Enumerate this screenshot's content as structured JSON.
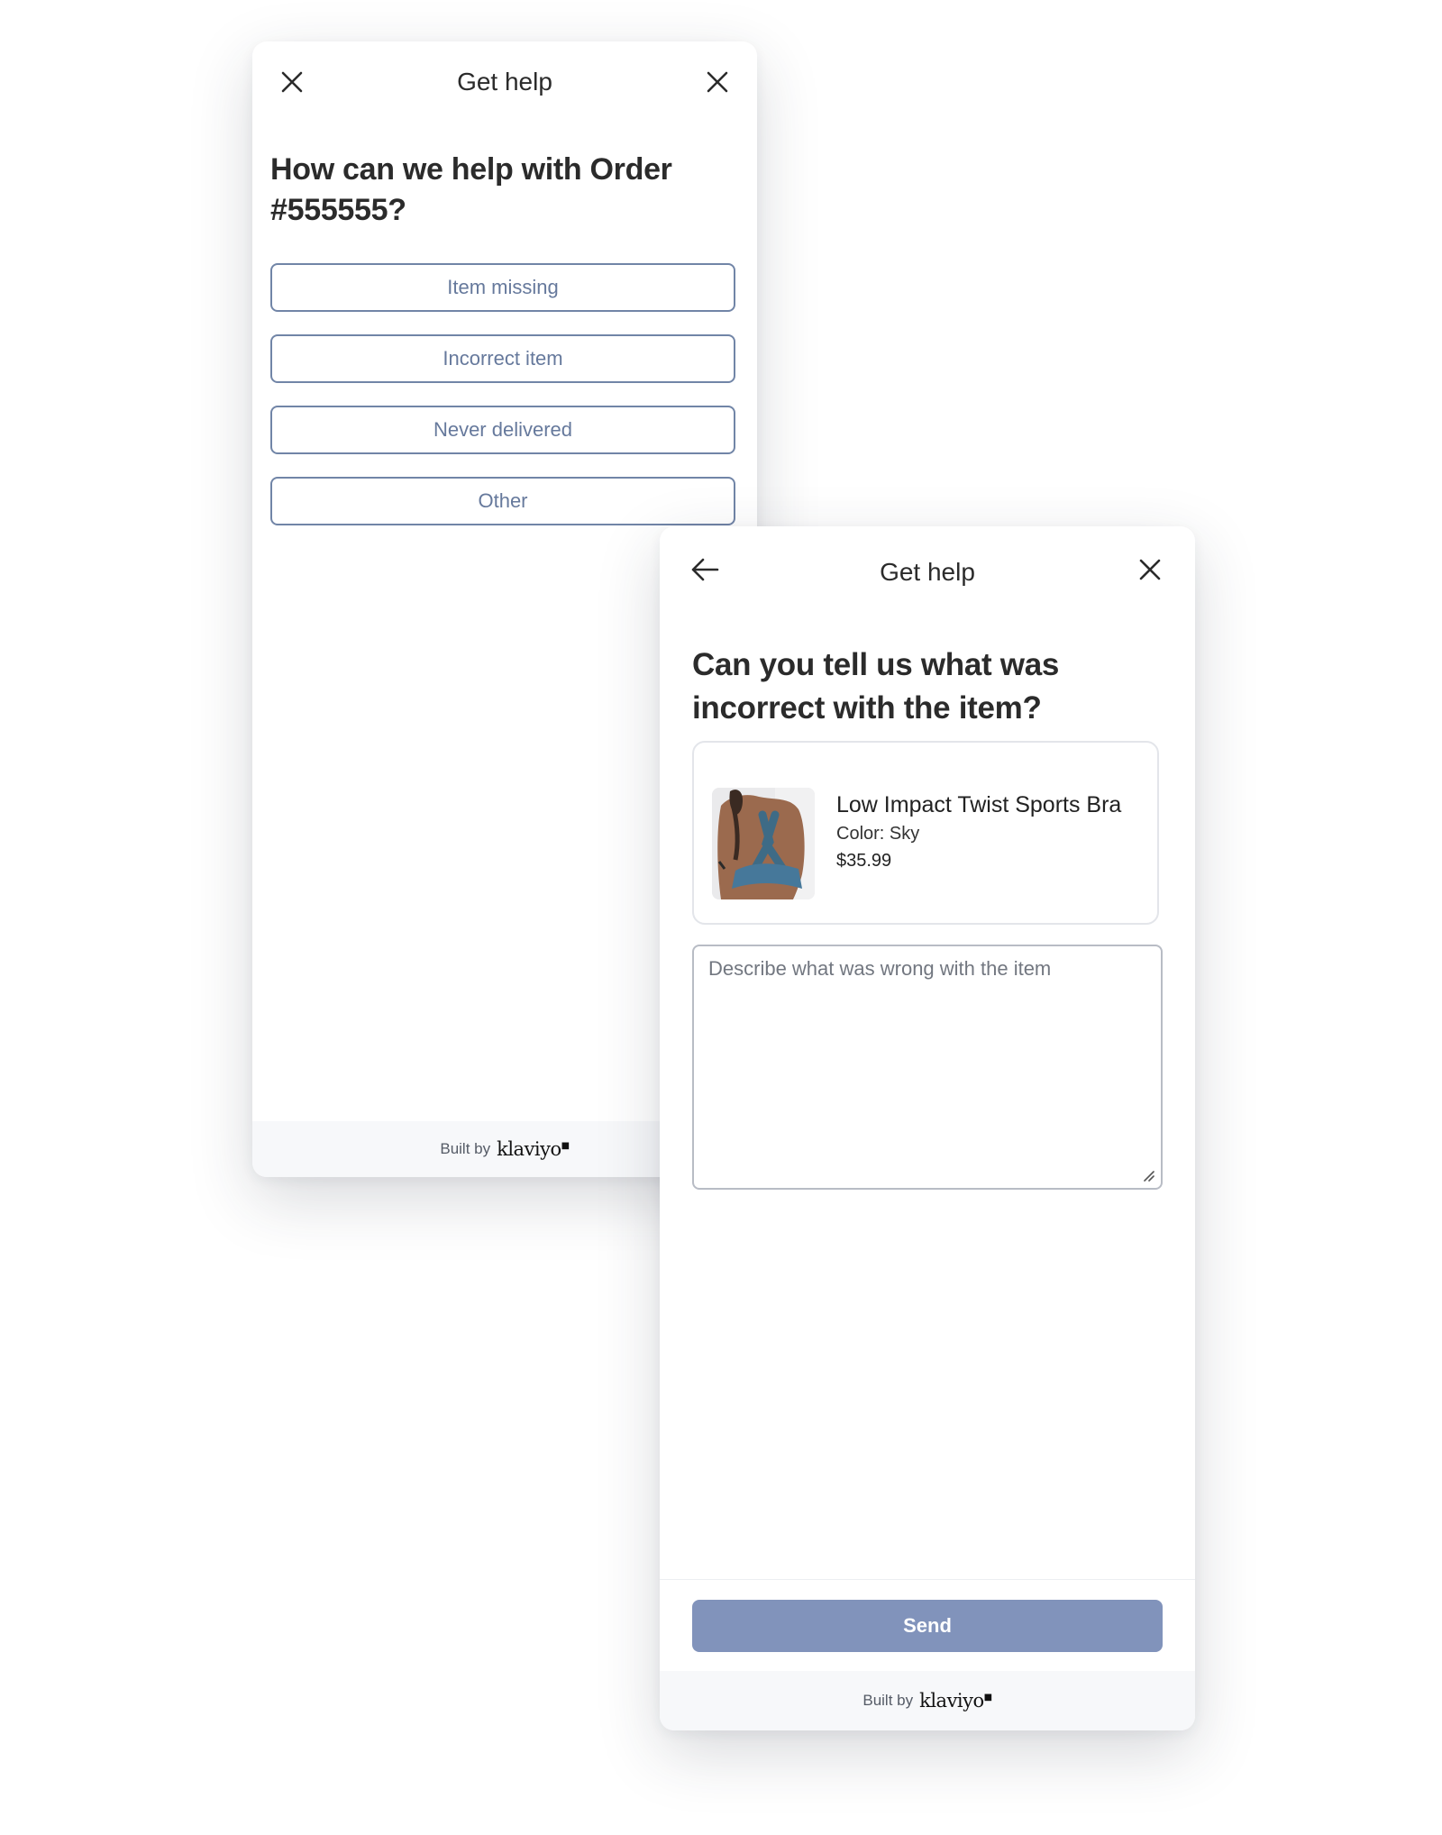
{
  "card1": {
    "header": {
      "title": "Get help",
      "left_icon": "close-icon",
      "right_icon": "close-icon"
    },
    "question": "How can we help with Order #555555?",
    "options": [
      {
        "label": "Item missing"
      },
      {
        "label": "Incorrect item"
      },
      {
        "label": "Never delivered"
      },
      {
        "label": "Other"
      }
    ],
    "footer": {
      "built_by": "Built by",
      "brand": "klaviyo"
    }
  },
  "card2": {
    "header": {
      "title": "Get help",
      "left_icon": "arrow-left-icon",
      "right_icon": "close-icon"
    },
    "question": "Can you tell us what was incorrect with the item?",
    "product": {
      "name": "Low Impact Twist Sports Bra",
      "color": "Color: Sky",
      "price": "$35.99"
    },
    "description": {
      "placeholder": "Describe what was wrong with the item",
      "value": ""
    },
    "send_label": "Send",
    "footer": {
      "built_by": "Built by",
      "brand": "klaviyo"
    }
  },
  "colors": {
    "option_border": "#7185a7",
    "option_text": "#66799c",
    "send_button": "#8193bb",
    "footer_bg": "#f7f8fa"
  }
}
